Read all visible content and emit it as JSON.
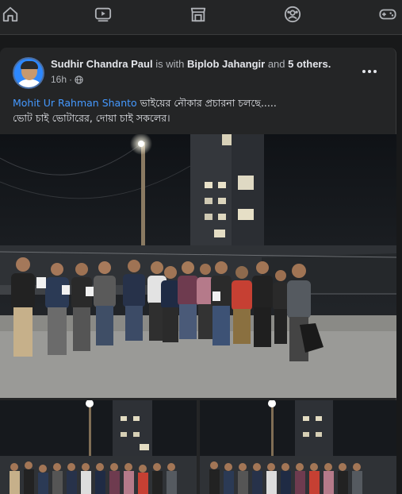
{
  "nav": {
    "items": [
      {
        "icon": "home-icon"
      },
      {
        "icon": "video-icon"
      },
      {
        "icon": "marketplace-icon"
      },
      {
        "icon": "groups-icon"
      },
      {
        "icon": "gaming-icon"
      }
    ]
  },
  "post": {
    "author": "Sudhir Chandra Paul",
    "with_text": "is with",
    "tagged": "Biplob Jahangir",
    "and_text": "and",
    "others": "5 others.",
    "time": "16h",
    "dot": "·",
    "privacy_icon": "globe-icon",
    "mention": "Mohit Ur Rahman Shanto",
    "text_line1_rest": " ভাইয়ের নৌকার প্রচারনা চলছে.....",
    "text_line2": "ভোট চাই ভোটারের, দোয়া চাই সকলের।"
  },
  "colors": {
    "background": "#18191a",
    "card": "#242526",
    "link": "#4599ff",
    "muted": "#b0b3b8"
  }
}
